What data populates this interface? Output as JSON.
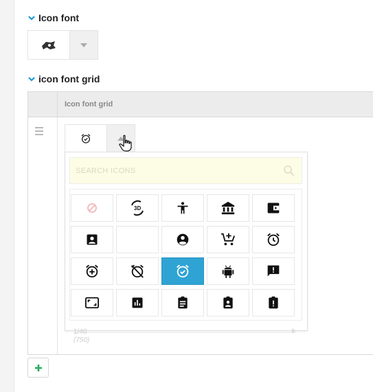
{
  "sections": {
    "icon_font": {
      "title": "Icon font"
    },
    "icon_font_grid": {
      "title": "icon font grid"
    }
  },
  "grid": {
    "column_header": "Icon font grid"
  },
  "dropdown": {
    "search_placeholder": "SEARCH ICONS",
    "pager_position": "1/40",
    "pager_total": "(750)",
    "selected_index": 12,
    "icons": [
      "ban-icon",
      "3d-rotation-icon",
      "accessibility-icon",
      "bank-icon",
      "wallet-icon",
      "account-box-icon",
      "blank-icon",
      "account-circle-icon",
      "add-shopping-cart-icon",
      "alarm-icon",
      "alarm-add-icon",
      "alarm-off-icon",
      "alarm-on-icon",
      "android-icon",
      "announcement-icon",
      "aspect-ratio-icon",
      "assessment-icon",
      "assignment-icon",
      "assignment-ind-icon",
      "assignment-late-icon"
    ]
  },
  "colors": {
    "accent": "#2fa4d4",
    "add_green": "#27ae60",
    "chevron_blue": "#1a9bd7",
    "search_bg": "#fdfde6"
  }
}
